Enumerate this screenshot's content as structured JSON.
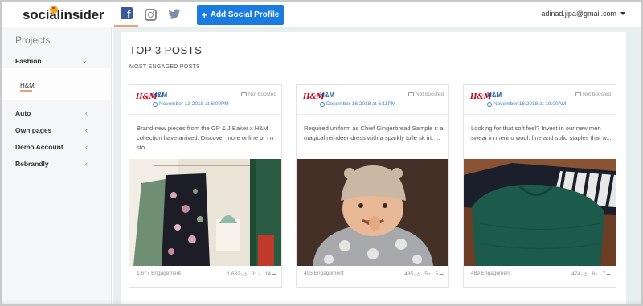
{
  "app": {
    "logo_text": "socialinsider",
    "user_email": "adinad.jipa@gmail.com"
  },
  "topbar": {
    "networks": [
      {
        "name": "facebook",
        "icon": "facebook-icon",
        "active": true
      },
      {
        "name": "instagram",
        "icon": "instagram-icon",
        "active": false
      },
      {
        "name": "twitter",
        "icon": "twitter-icon",
        "active": false
      }
    ],
    "add_button_label": "Add Social Profile",
    "accent_color": "#1a7be0"
  },
  "sidebar": {
    "title": "Projects",
    "items": [
      {
        "label": "Fashion",
        "chevron": "down"
      },
      {
        "label": "Auto",
        "chevron": "left"
      },
      {
        "label": "Own pages",
        "chevron": "left"
      },
      {
        "label": "Demo Account",
        "chevron": "left"
      },
      {
        "label": "Rebrandly",
        "chevron": "left"
      }
    ],
    "sub_item": "H&M"
  },
  "main": {
    "title": "TOP 3 POSTS",
    "subtitle": "MOST ENGAGED POSTS",
    "posts": [
      {
        "logo": "H&M",
        "page": "H&M",
        "date": "November 13 2018 at 6:00PM",
        "boost": "Not boosted",
        "caption": "Brand-new pieces from the GP & J Baker x H&M collection have arrived. Discover more online or i n sto...",
        "engagement": "1,677 Engagement",
        "likes": "1,632",
        "comments": "31",
        "shares": "14"
      },
      {
        "logo": "H&M",
        "page": "H&M",
        "date": "December 16 2018 at 6:11PM",
        "boost": "Not boosted",
        "caption": "Required uniform as Chief Gingerbread Sample r: a magical reindeer dress with a sparkly tulle sk irt. ...",
        "engagement": "495 Engagement",
        "likes": "485",
        "comments": "5",
        "shares": "5"
      },
      {
        "logo": "H&M",
        "page": "H&M",
        "date": "November 16 2018 at 10:00AM",
        "boost": "Not boosted",
        "caption": "Looking for that soft feel? Invest in our new men swear in merino wool: fine and solid staples that w...",
        "engagement": "489 Engagement",
        "likes": "474",
        "comments": "8",
        "shares": "7"
      }
    ]
  }
}
